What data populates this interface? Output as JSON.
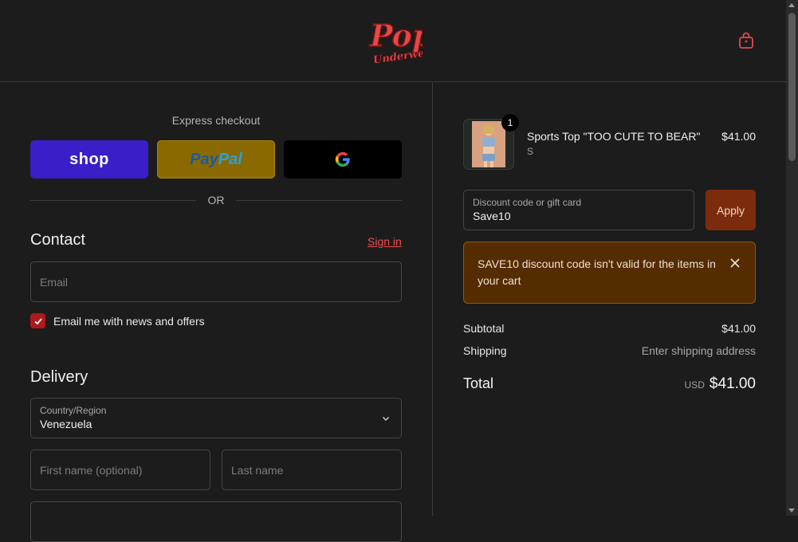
{
  "header": {
    "logo_icon": "pop-underwear-logo",
    "cart_icon": "shopping-bag-icon"
  },
  "express": {
    "title": "Express checkout",
    "shop_label": "shop",
    "paypal_pay": "Pay",
    "paypal_pal": "Pal",
    "gpay_icon": "google-g-icon",
    "or_label": "OR"
  },
  "contact": {
    "title": "Contact",
    "sign_in": "Sign in",
    "email_placeholder": "Email",
    "newsletter_label": "Email me with news and offers",
    "newsletter_checked": true
  },
  "delivery": {
    "title": "Delivery",
    "country_label": "Country/Region",
    "country_value": "Venezuela",
    "first_name_placeholder": "First name (optional)",
    "last_name_placeholder": "Last name"
  },
  "summary": {
    "product": {
      "quantity": "1",
      "name": "Sports Top \"TOO CUTE TO BEAR\"",
      "variant": "S",
      "price": "$41.00"
    },
    "discount": {
      "label": "Discount code or gift card",
      "value": "Save10",
      "apply_label": "Apply"
    },
    "alert": {
      "message": "SAVE10 discount code isn't valid for the items in your cart"
    },
    "subtotal_label": "Subtotal",
    "subtotal_value": "$41.00",
    "shipping_label": "Shipping",
    "shipping_value": "Enter shipping address",
    "total_label": "Total",
    "currency": "USD",
    "total_value": "$41.00"
  },
  "colors": {
    "background": "#1c1c1c",
    "accent_red": "#b0181c",
    "apply_button": "#7c2c0d",
    "alert_bg": "#552c00"
  }
}
